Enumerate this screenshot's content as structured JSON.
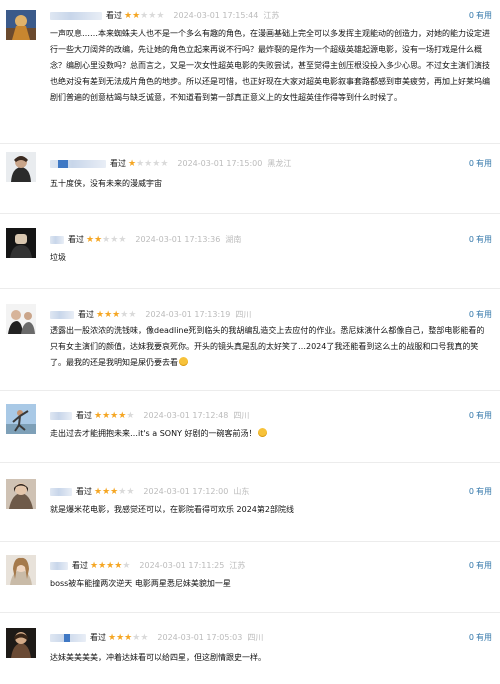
{
  "comments": [
    {
      "rated_label": "看过",
      "rating": 2,
      "time": "2024-03-01 17:15:44",
      "location": "江苏",
      "useful_count": "0",
      "useful_label": "有用",
      "avatar": "avatar-1",
      "text": "一声叹息……本来蜘蛛夫人也不是一个多么有趣的角色，在漫画基础上完全可以多发挥主观能动的创造力，对她的能力设定进行一些大刀阔斧的改编，先让她的角色立起来再说不行吗？最炸裂的是作为一个超级英雄起源电影，没有一场打戏是什么概念？编剧心里没数吗？总而言之，又是一次女性超英电影的失败尝试，甚至觉得主创压根没投入多少心思。不过女主演们演技也绝对没有差到无法成片角色的地步。所以还是可惜，也正好现在大家对超英电影叙事套路都感到审美疲劳，再加上好莱坞编剧们普遍的创意枯竭与缺乏诚意，不知道看到第一部真正意义上的女性超英佳作得等到什么时候了。"
    },
    {
      "rated_label": "看过",
      "rating": 1,
      "time": "2024-03-01 17:15:00",
      "location": "黑龙江",
      "useful_count": "0",
      "useful_label": "有用",
      "avatar": "avatar-2",
      "text": "五十度侠，没有未来的漫威宇宙"
    },
    {
      "rated_label": "看过",
      "rating": 2,
      "time": "2024-03-01 17:13:36",
      "location": "湖南",
      "useful_count": "0",
      "useful_label": "有用",
      "avatar": "avatar-3",
      "text": "垃圾"
    },
    {
      "rated_label": "看过",
      "rating": 3,
      "time": "2024-03-01 17:13:19",
      "location": "四川",
      "useful_count": "0",
      "useful_label": "有用",
      "avatar": "avatar-4",
      "text": "透露出一股浓浓的洗钱味，像deadline死到临头的我胡编乱造交上去应付的作业。悉尼妹演什么都像自己，整部电影能看的只有女主演们的颜值，达妹我要哀死你。开头的镜头真是乱的太好笑了…2024了我还能看到这么土的战服和口号我真的笑了。最我的还是我明知是屎仍要去看"
    },
    {
      "rated_label": "看过",
      "rating": 4,
      "time": "2024-03-01 17:12:48",
      "location": "四川",
      "useful_count": "0",
      "useful_label": "有用",
      "avatar": "avatar-5",
      "text": "走出过去才能拥抱未来…it's a SONY 好剧的一碗客前汤！"
    },
    {
      "rated_label": "看过",
      "rating": 3,
      "time": "2024-03-01 17:12:00",
      "location": "山东",
      "useful_count": "0",
      "useful_label": "有用",
      "avatar": "avatar-6",
      "text": "就是爆米花电影，我感觉还可以，在影院看得可欢乐 2024第2部院线"
    },
    {
      "rated_label": "看过",
      "rating": 4,
      "time": "2024-03-01 17:11:25",
      "location": "江苏",
      "useful_count": "0",
      "useful_label": "有用",
      "avatar": "avatar-7",
      "text": "boss被车能撞两次逆天 电影两星悉尼妹美貌加一星"
    },
    {
      "rated_label": "看过",
      "rating": 3,
      "time": "2024-03-01 17:05:03",
      "location": "四川",
      "useful_count": "0",
      "useful_label": "有用",
      "avatar": "avatar-8",
      "text": "达妹美美美美，冲着达妹看可以给四星，但这剧情跟史一样。"
    }
  ]
}
